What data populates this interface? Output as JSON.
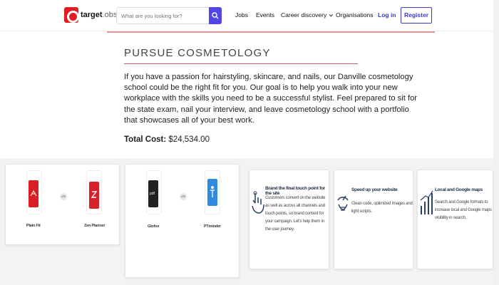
{
  "brand": {
    "name_bold": "target",
    "name_rest": ".obs"
  },
  "search": {
    "placeholder": "What are you looking for?"
  },
  "nav": {
    "jobs": "Jobs",
    "events": "Events",
    "career_discovery": "Career discovery",
    "organisations": "Organisations",
    "login": "Log in",
    "register": "Register"
  },
  "main": {
    "title": "PURSUE COSMETOLOGY",
    "description": "If you have a passion for hairstyling, skincare, and nails, our Danville cosmetology school could be the right fit for you. Our goal is to help you walk into your new workplace with the skills you need to be a successful stylist. Feel prepared to sit for the state exam, nail your interview, and leave cosmetology school with a portfolio that showcases all of your best work.",
    "cost_label": "Total Cost:",
    "cost_value": "$24,534.00"
  },
  "comparisons": [
    {
      "left": "Plain Fit",
      "right": "Zen Planner",
      "vs": "VS"
    },
    {
      "left": "Glofox",
      "right": "PTminder",
      "vs": "VS"
    }
  ],
  "features": [
    {
      "title": "Brand the final touch point for the site",
      "text": "Customers convert on the website as well as across all channels and touch points, so brand content for your campaign. Let's help them in the user journey.",
      "icon": "hand-touch-icon"
    },
    {
      "title": "Speed up your website",
      "text": "Clean code, optimized images and light scripts.",
      "icon": "speed-gauge-icon"
    },
    {
      "title": "Local and Google maps",
      "text": "Search and Google formats to increase local and Google maps visibility in search.",
      "icon": "growth-chart-icon"
    }
  ],
  "colors": {
    "accent": "#3b38c8",
    "brand_red": "#e31b23"
  }
}
